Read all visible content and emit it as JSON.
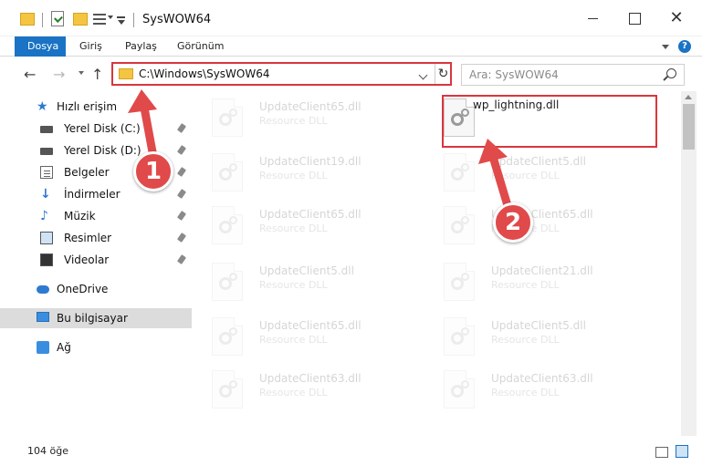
{
  "window": {
    "title": "SysWOW64"
  },
  "ribbon": {
    "tabs": [
      "Dosya",
      "Giriş",
      "Paylaş",
      "Görünüm"
    ]
  },
  "address": {
    "path": "C:\\Windows\\SysWOW64",
    "search_placeholder": "Ara: SysWOW64"
  },
  "sidebar": {
    "items": [
      {
        "label": "Hızlı erişim",
        "icon": "star-icon"
      },
      {
        "label": "Yerel Disk (C:)",
        "icon": "drive-icon",
        "pinned": true
      },
      {
        "label": "Yerel Disk (D:)",
        "icon": "drive-icon",
        "pinned": true
      },
      {
        "label": "Belgeler",
        "icon": "document-icon",
        "pinned": true
      },
      {
        "label": "İndirmeler",
        "icon": "download-icon",
        "pinned": true
      },
      {
        "label": "Müzik",
        "icon": "music-icon",
        "pinned": true
      },
      {
        "label": "Resimler",
        "icon": "pictures-icon",
        "pinned": true
      },
      {
        "label": "Videolar",
        "icon": "video-icon",
        "pinned": true
      },
      {
        "label": "OneDrive",
        "icon": "cloud-icon"
      },
      {
        "label": "Bu bilgisayar",
        "icon": "computer-icon",
        "selected": true
      },
      {
        "label": "Ağ",
        "icon": "network-icon"
      }
    ]
  },
  "files": {
    "left": [
      {
        "name": "UpdateClient65.dll",
        "type": "Resource DLL"
      },
      {
        "name": "UpdateClient19.dll",
        "type": "Resource DLL"
      },
      {
        "name": "UpdateClient65.dll",
        "type": "Resource DLL"
      },
      {
        "name": "UpdateClient5.dll",
        "type": "Resource DLL"
      },
      {
        "name": "UpdateClient65.dll",
        "type": "Resource DLL"
      },
      {
        "name": "UpdateClient63.dll",
        "type": "Resource DLL"
      }
    ],
    "right": [
      {
        "name": "wp_lightning.dll",
        "type": ""
      },
      {
        "name": "UpdateClient5.dll",
        "type": "Resource DLL"
      },
      {
        "name": "UpdateClient65.dll",
        "type": "Resource DLL"
      },
      {
        "name": "UpdateClient21.dll",
        "type": "Resource DLL"
      },
      {
        "name": "UpdateClient5.dll",
        "type": "Resource DLL"
      },
      {
        "name": "UpdateClient63.dll",
        "type": "Resource DLL"
      }
    ]
  },
  "status": {
    "count": "104 öğe"
  },
  "annotations": {
    "step1": "1",
    "step2": "2",
    "accent": "#e04a4a"
  }
}
